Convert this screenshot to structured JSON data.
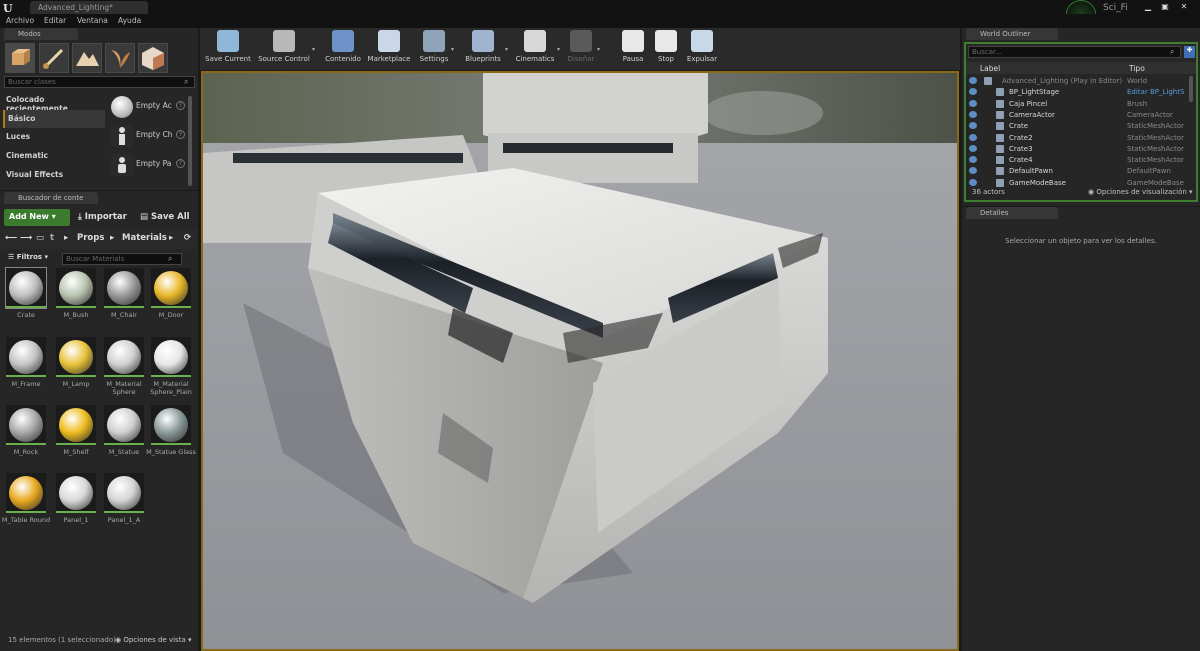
{
  "window": {
    "document_tab": "Advanced_Lighting*",
    "project_name": "Sci_Fi",
    "menu": [
      "Archivo",
      "Editar",
      "Ventana",
      "Ayuda"
    ]
  },
  "modes_panel": {
    "tab": "Modos",
    "search_placeholder": "Buscar clases",
    "categories": [
      "Colocado recientemente",
      "Básico",
      "Luces",
      "Cinematic",
      "Visual Effects"
    ],
    "selected_category": "Básico",
    "items": [
      "Empty Ac",
      "Empty Ch",
      "Empty Pa"
    ]
  },
  "content_browser": {
    "tab": "Buscador de conte",
    "add_new": "Add New",
    "import": "Importar",
    "save_all": "Save All",
    "path": [
      "t",
      "Props",
      "Materials"
    ],
    "filters": "Filtros",
    "search_placeholder": "Buscar Materials",
    "assets": [
      {
        "name": "Crate",
        "color": "#bfbfbf"
      },
      {
        "name": "M_Bush",
        "color": "#b9c4b0"
      },
      {
        "name": "M_Chair",
        "color": "#9a9a9a"
      },
      {
        "name": "M_Door",
        "color": "#e8b628"
      },
      {
        "name": "M_Frame",
        "color": "#c4c4c4"
      },
      {
        "name": "M_Lamp",
        "color": "#e8c23a"
      },
      {
        "name": "M_Material Sphere",
        "color": "#d0d0d0"
      },
      {
        "name": "M_Material Sphere_Plain",
        "color": "#e6e6e6"
      },
      {
        "name": "M_Rock",
        "color": "#a8a8a8"
      },
      {
        "name": "M_Shelf",
        "color": "#eebc1f"
      },
      {
        "name": "M_Statue",
        "color": "#cfcfcf"
      },
      {
        "name": "M_Statue Glass",
        "color": "#8a9a9a"
      },
      {
        "name": "M_Table Round",
        "color": "#e8a91f"
      },
      {
        "name": "Panel_1",
        "color": "#d8d8d8"
      },
      {
        "name": "Panel_1_A",
        "color": "#d4d4d4"
      }
    ],
    "status": "15 elementos (1 seleccionado)",
    "view_options": "Opciones de vista"
  },
  "toolbar": [
    {
      "label": "Save Current",
      "icon": "save-icon",
      "color": "#8fb7d8"
    },
    {
      "label": "Source Control",
      "icon": "source-control-icon",
      "color": "#b8b8b8"
    },
    {
      "label": "Contenido",
      "icon": "content-icon",
      "color": "#6d93c8"
    },
    {
      "label": "Marketplace",
      "icon": "marketplace-icon",
      "color": "#c9d7e8"
    },
    {
      "label": "Settings",
      "icon": "settings-icon",
      "color": "#8fa3b8"
    },
    {
      "label": "Blueprints",
      "icon": "blueprints-icon",
      "color": "#a0b4d0"
    },
    {
      "label": "Cinematics",
      "icon": "cinematics-icon",
      "color": "#d8d8d8"
    },
    {
      "label": "Diseñar",
      "icon": "build-icon",
      "color": "#5a5a5a"
    },
    {
      "label": "Pausa",
      "icon": "pause-icon",
      "color": "#e8e8e8"
    },
    {
      "label": "Stop",
      "icon": "stop-icon",
      "color": "#e8e8e8"
    },
    {
      "label": "Expulsar",
      "icon": "eject-icon",
      "color": "#c8d8e8"
    }
  ],
  "world_outliner": {
    "tab": "World Outliner",
    "search_placeholder": "Buscar...",
    "col_label": "Label",
    "col_type": "Tipo",
    "rows": [
      {
        "name": "Advanced_Lighting (Play in Editor)",
        "type": "World"
      },
      {
        "name": "BP_LightStage",
        "type": "Editar BP_LightS"
      },
      {
        "name": "Caja Pincel",
        "type": "Brush"
      },
      {
        "name": "CameraActor",
        "type": "CameraActor"
      },
      {
        "name": "Crate",
        "type": "StaticMeshActor"
      },
      {
        "name": "Crate2",
        "type": "StaticMeshActor"
      },
      {
        "name": "Crate3",
        "type": "StaticMeshActor"
      },
      {
        "name": "Crate4",
        "type": "StaticMeshActor"
      },
      {
        "name": "DefaultPawn",
        "type": "DefaultPawn"
      },
      {
        "name": "GameModeBase",
        "type": "GameModeBase"
      }
    ],
    "actor_count": "36 actors",
    "view_options": "Opciones de visualización"
  },
  "details": {
    "tab": "Detalles",
    "message": "Seleccionar un objeto para ver los detalles."
  }
}
